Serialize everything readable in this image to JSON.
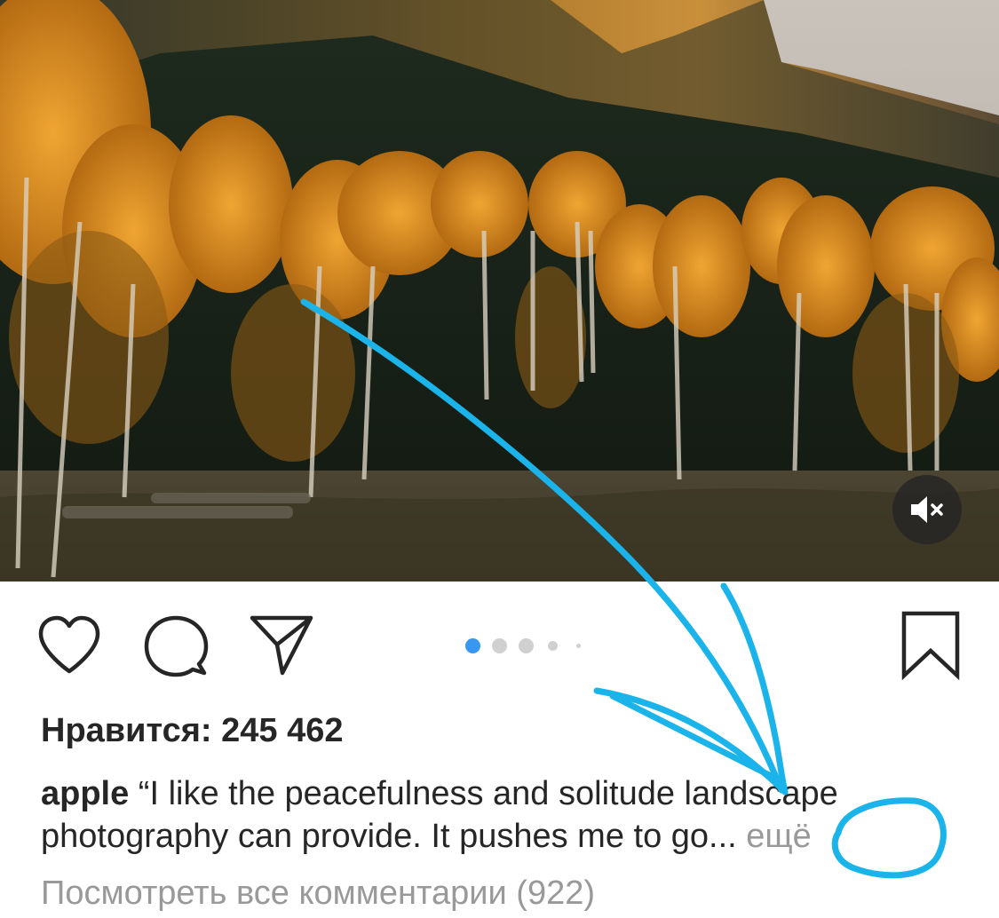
{
  "post": {
    "media": {
      "description_icon": "landscape-photo",
      "mute_icon": "speaker-muted-icon"
    },
    "actions": {
      "like_icon": "heart-icon",
      "comment_icon": "comment-bubble-icon",
      "share_icon": "paper-plane-icon",
      "save_icon": "bookmark-icon"
    },
    "carousel": {
      "total_dots": 5,
      "active_index": 0,
      "active_color": "#3897f0"
    },
    "likes_text": "Нравится: 245 462",
    "caption": {
      "username": "apple",
      "text": " “I like the peacefulness and solitude landscape photography can provide. It pushes me to go...",
      "more_label": " ещё"
    },
    "view_comments": "Посмотреть все комментарии (922)"
  },
  "annotation": {
    "color": "#1ab4ea"
  }
}
